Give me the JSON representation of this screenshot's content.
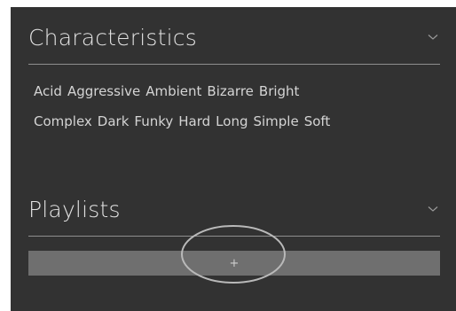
{
  "characteristics": {
    "title": "Characteristics",
    "chevron_icon": "chevron-down-icon",
    "tags": [
      "Acid",
      "Aggressive",
      "Ambient",
      "Bizarre",
      "Bright",
      "Complex",
      "Dark",
      "Funky",
      "Hard",
      "Long",
      "Simple",
      "Soft"
    ]
  },
  "playlists": {
    "title": "Playlists",
    "chevron_icon": "chevron-down-icon",
    "add_label": "+"
  },
  "colors": {
    "panel_background": "#323232",
    "text": "#e2e2e2",
    "add_bar": "#6f6f6f",
    "highlight_outline": "#b9b9b9"
  }
}
